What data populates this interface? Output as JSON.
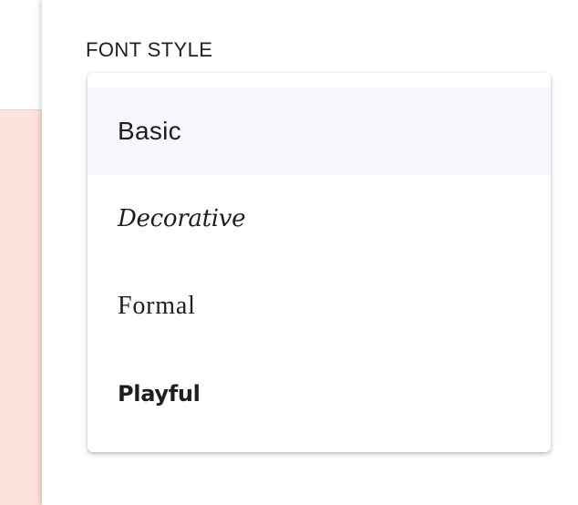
{
  "panel": {
    "section_label": "FONT STYLE"
  },
  "font_style_menu": {
    "selected": "Basic",
    "options": [
      {
        "label": "Basic",
        "style": "basic"
      },
      {
        "label": "Decorative",
        "style": "decorative"
      },
      {
        "label": "Formal",
        "style": "formal"
      },
      {
        "label": "Playful",
        "style": "playful"
      }
    ]
  },
  "colors": {
    "background_accent": "#fde3da",
    "selected_item_bg": "#f6f8fd",
    "text": "#1e1e1e"
  }
}
